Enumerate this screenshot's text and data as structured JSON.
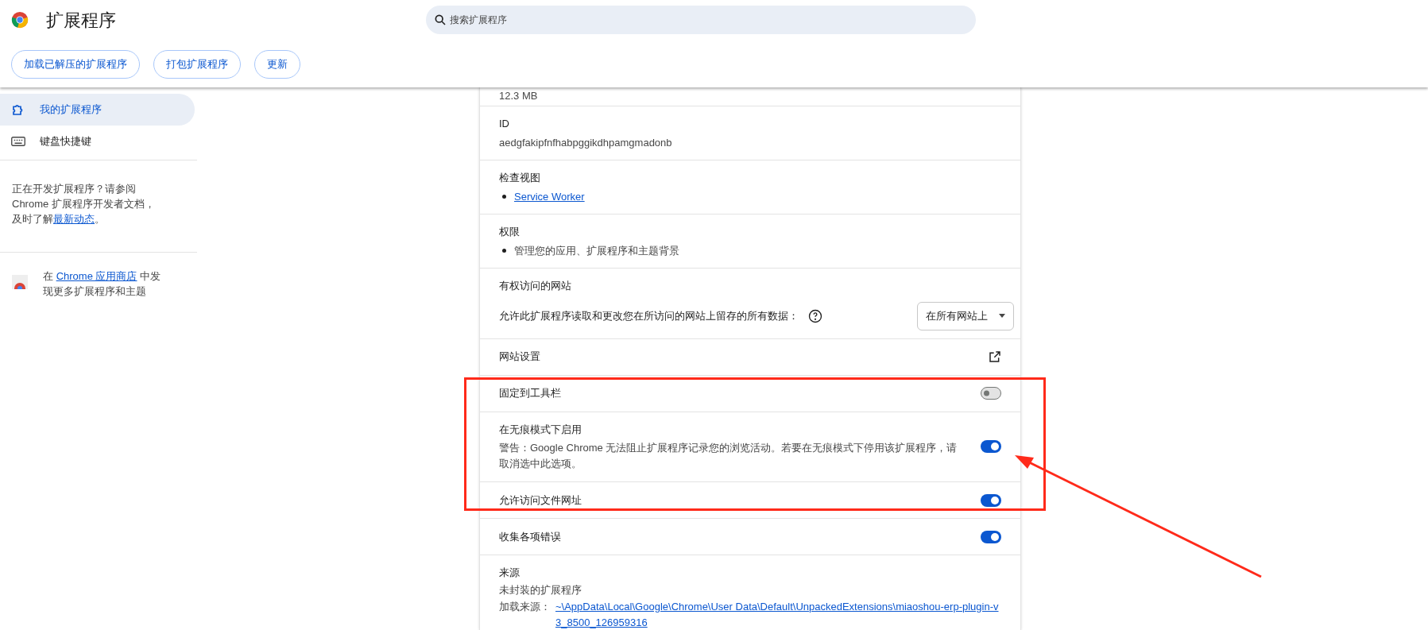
{
  "header": {
    "title": "扩展程序",
    "search": {
      "placeholder": "搜索扩展程序"
    },
    "buttons": [
      "加载已解压的扩展程序",
      "打包扩展程序",
      "更新"
    ]
  },
  "sidebar": {
    "items": [
      {
        "label": "我的扩展程序",
        "selected": true,
        "kind": "puzzle"
      },
      {
        "label": "键盘快捷键",
        "selected": false,
        "kind": "keyboard"
      }
    ],
    "dev_note": {
      "text": "正在开发扩展程序？请参阅 Chrome 扩展程序开发者文档，及时了解",
      "link": "最新动态",
      "suffix": "。"
    },
    "store_note": {
      "prefix": "在 ",
      "link": "Chrome 应用商店",
      "suffix": " 中发现更多扩展程序和主题"
    }
  },
  "details": {
    "sections": [
      {
        "kind": "value",
        "value": "12.3 MB"
      },
      {
        "kind": "field",
        "label": "ID",
        "value": "aedgfakipfnfhabpggikdhpamgmadonb"
      },
      {
        "kind": "links",
        "label": "检查视图",
        "items": [
          "Service Worker"
        ]
      },
      {
        "kind": "bullets",
        "label": "权限",
        "items": [
          "管理您的应用、扩展程序和主题背景"
        ]
      },
      {
        "kind": "access",
        "label": "有权访问的网站",
        "description": "允许此扩展程序读取和更改您在所访问的网站上留存的所有数据：",
        "select": "在所有网站上"
      },
      {
        "kind": "external",
        "label": "网站设置"
      },
      {
        "kind": "toggle",
        "label": "固定到工具栏",
        "on": false
      },
      {
        "kind": "toggle",
        "label": "在无痕模式下启用",
        "description": "警告：Google Chrome 无法阻止扩展程序记录您的浏览活动。若要在无痕模式下停用该扩展程序，请取消选中此选项。",
        "on": true
      },
      {
        "kind": "toggle",
        "label": "允许访问文件网址",
        "on": true
      },
      {
        "kind": "toggle",
        "label": "收集各项错误",
        "on": true
      },
      {
        "kind": "source",
        "label": "来源",
        "value": "未封装的扩展程序",
        "path_label": "加载来源：",
        "path": "~\\AppData\\Local\\Google\\Chrome\\User Data\\Default\\UnpackedExtensions\\miaoshou-erp-plugin-v3_8500_126959316"
      }
    ]
  }
}
